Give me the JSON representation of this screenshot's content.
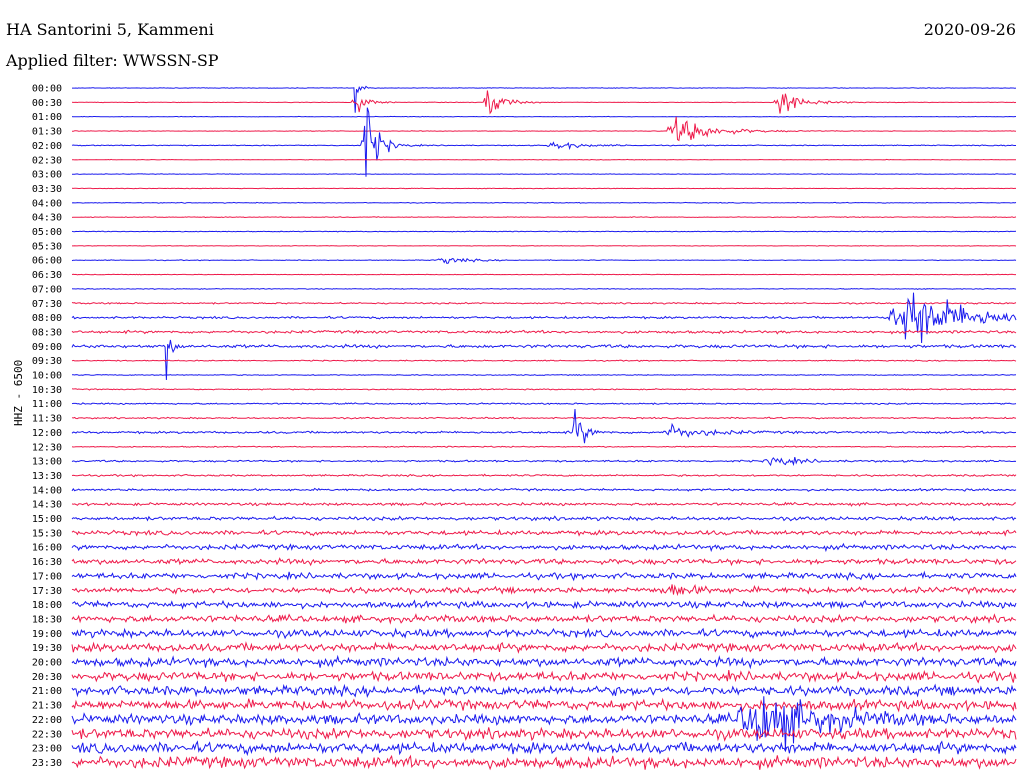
{
  "header": {
    "station": "HA Santorini 5, Kammeni",
    "filter": "Applied filter: WWSSN-SP",
    "date": "2020-09-26"
  },
  "channel_label": "HHZ - 6500",
  "colors": {
    "even_line": "#1a1aee",
    "odd_line": "#ee1a4a"
  },
  "chart_data": {
    "type": "line",
    "title": "HA Santorini 5, Kammeni",
    "subtitle": "Applied filter: WWSSN-SP",
    "ylabel": "HHZ - 6500",
    "row_labels": [
      "00:00",
      "00:30",
      "01:00",
      "01:30",
      "02:00",
      "02:30",
      "03:00",
      "03:30",
      "04:00",
      "04:30",
      "05:00",
      "05:30",
      "06:00",
      "06:30",
      "07:00",
      "07:30",
      "08:00",
      "08:30",
      "09:00",
      "09:30",
      "10:00",
      "10:30",
      "11:00",
      "11:30",
      "12:00",
      "12:30",
      "13:00",
      "13:30",
      "14:00",
      "14:30",
      "15:00",
      "15:30",
      "16:00",
      "16:30",
      "17:00",
      "17:30",
      "18:00",
      "18:30",
      "19:00",
      "19:30",
      "20:00",
      "20:30",
      "21:00",
      "21:30",
      "22:00",
      "22:30",
      "23:00",
      "23:30"
    ],
    "noise_level": [
      0.03,
      0.03,
      0.03,
      0.03,
      0.05,
      0.03,
      0.03,
      0.03,
      0.04,
      0.04,
      0.04,
      0.03,
      0.04,
      0.03,
      0.04,
      0.08,
      0.12,
      0.15,
      0.18,
      0.06,
      0.05,
      0.06,
      0.08,
      0.08,
      0.12,
      0.06,
      0.1,
      0.1,
      0.12,
      0.15,
      0.2,
      0.25,
      0.28,
      0.3,
      0.32,
      0.32,
      0.35,
      0.38,
      0.42,
      0.45,
      0.48,
      0.5,
      0.52,
      0.55,
      0.55,
      0.58,
      0.6,
      0.62
    ],
    "events": [
      {
        "row": 0,
        "t": 0.3,
        "amp": 3.5,
        "dur": 0.003
      },
      {
        "row": 1,
        "t": 0.3,
        "amp": 1.5,
        "dur": 0.01
      },
      {
        "row": 1,
        "t": 0.44,
        "amp": 2.5,
        "dur": 0.012
      },
      {
        "row": 1,
        "t": 0.75,
        "amp": 1.6,
        "dur": 0.02
      },
      {
        "row": 3,
        "t": 0.64,
        "amp": 1.8,
        "dur": 0.03
      },
      {
        "row": 4,
        "t": 0.31,
        "amp": 6.0,
        "dur": 0.01
      },
      {
        "row": 4,
        "t": 0.51,
        "amp": 0.6,
        "dur": 0.02
      },
      {
        "row": 12,
        "t": 0.39,
        "amp": 0.5,
        "dur": 0.02
      },
      {
        "row": 16,
        "t": 0.88,
        "amp": 4.0,
        "dur": 0.05
      },
      {
        "row": 18,
        "t": 0.1,
        "amp": 3.5,
        "dur": 0.004
      },
      {
        "row": 24,
        "t": 0.53,
        "amp": 4.0,
        "dur": 0.008
      },
      {
        "row": 24,
        "t": 0.63,
        "amp": 0.9,
        "dur": 0.03
      },
      {
        "row": 26,
        "t": 0.74,
        "amp": 0.7,
        "dur": 0.02
      },
      {
        "row": 35,
        "t": 0.63,
        "amp": 0.8,
        "dur": 0.02
      },
      {
        "row": 44,
        "t": 0.72,
        "amp": 4.0,
        "dur": 0.05
      }
    ]
  }
}
